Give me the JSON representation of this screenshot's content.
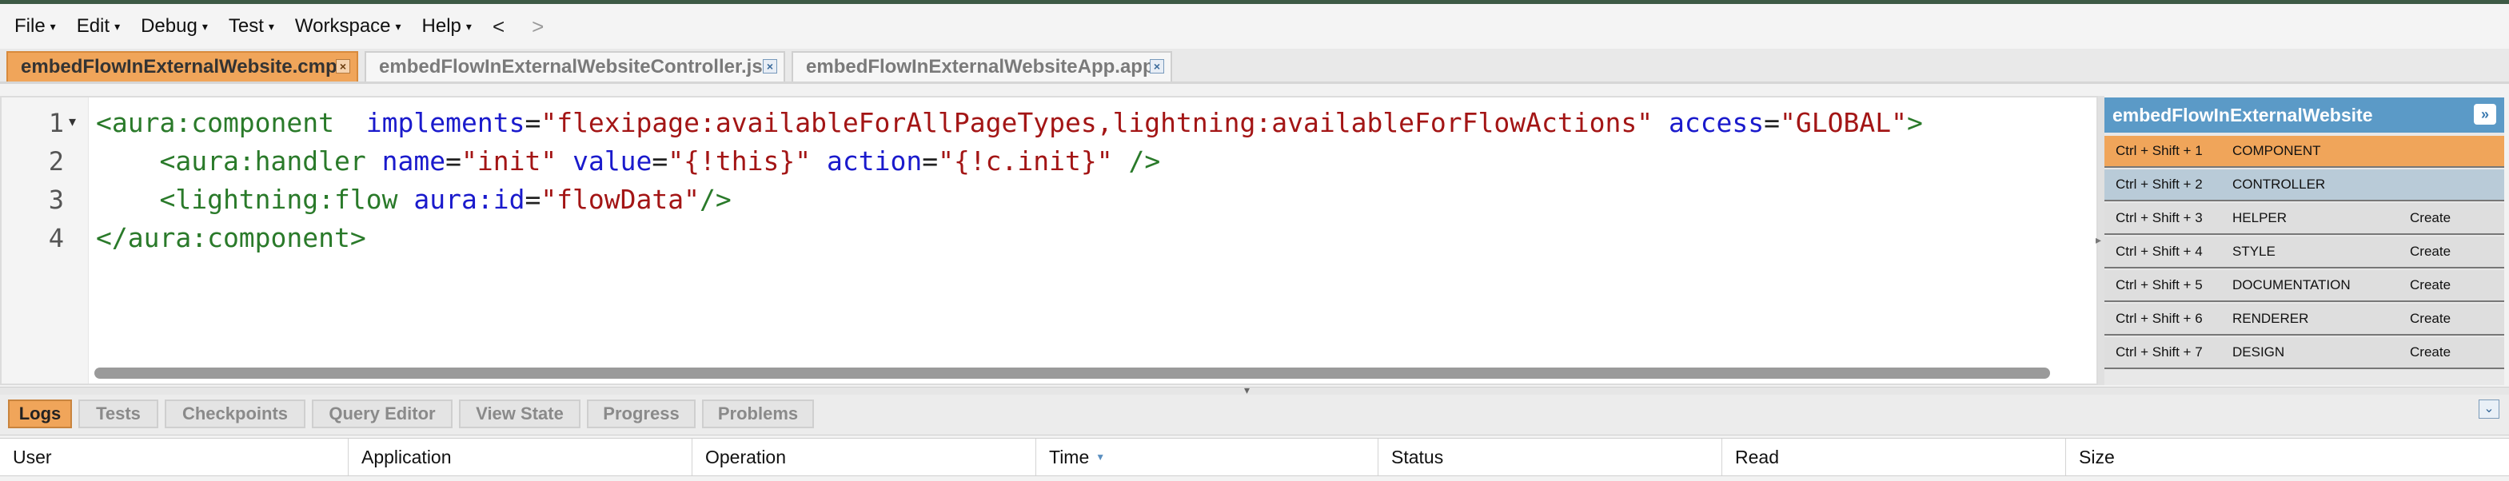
{
  "menu": {
    "items": [
      "File",
      "Edit",
      "Debug",
      "Test",
      "Workspace",
      "Help"
    ],
    "back": "<",
    "forward": ">"
  },
  "tabs": [
    {
      "label": "embedFlowInExternalWebsite.cmp",
      "active": true
    },
    {
      "label": "embedFlowInExternalWebsiteController.js",
      "active": false
    },
    {
      "label": "embedFlowInExternalWebsiteApp.app",
      "active": false
    }
  ],
  "tab_close_glyph": "×",
  "editor": {
    "line_numbers": [
      "1",
      "2",
      "3",
      "4"
    ],
    "fold_marker": "▾",
    "lines": [
      [
        {
          "t": "tag",
          "v": "<aura:component  "
        },
        {
          "t": "attr",
          "v": "implements"
        },
        {
          "t": "eq",
          "v": "="
        },
        {
          "t": "str",
          "v": "\"flexipage:availableForAllPageTypes,lightning:availableForFlowActions\""
        },
        {
          "t": "eq",
          "v": " "
        },
        {
          "t": "attr",
          "v": "access"
        },
        {
          "t": "eq",
          "v": "="
        },
        {
          "t": "str",
          "v": "\"GLOBAL\""
        },
        {
          "t": "tag",
          "v": ">"
        }
      ],
      [
        {
          "t": "tag",
          "v": "    <aura:handler "
        },
        {
          "t": "attr",
          "v": "name"
        },
        {
          "t": "eq",
          "v": "="
        },
        {
          "t": "str",
          "v": "\"init\""
        },
        {
          "t": "eq",
          "v": " "
        },
        {
          "t": "attr",
          "v": "value"
        },
        {
          "t": "eq",
          "v": "="
        },
        {
          "t": "str",
          "v": "\"{!this}\""
        },
        {
          "t": "eq",
          "v": " "
        },
        {
          "t": "attr",
          "v": "action"
        },
        {
          "t": "eq",
          "v": "="
        },
        {
          "t": "str",
          "v": "\"{!c.init}\""
        },
        {
          "t": "tag",
          "v": " />"
        }
      ],
      [
        {
          "t": "tag",
          "v": "    <lightning:flow "
        },
        {
          "t": "attr",
          "v": "aura:id"
        },
        {
          "t": "eq",
          "v": "="
        },
        {
          "t": "str",
          "v": "\"flowData\""
        },
        {
          "t": "tag",
          "v": "/>"
        }
      ],
      [
        {
          "t": "tag",
          "v": "</aura:component>"
        }
      ]
    ]
  },
  "side_panel": {
    "title": "embedFlowInExternalWebsite",
    "collapse_glyph": "»",
    "rows": [
      {
        "shortcut": "Ctrl + Shift + 1",
        "name": "COMPONENT",
        "action": "",
        "state": "active"
      },
      {
        "shortcut": "Ctrl + Shift + 2",
        "name": "CONTROLLER",
        "action": "",
        "state": "ctrl"
      },
      {
        "shortcut": "Ctrl + Shift + 3",
        "name": "HELPER",
        "action": "Create",
        "state": ""
      },
      {
        "shortcut": "Ctrl + Shift + 4",
        "name": "STYLE",
        "action": "Create",
        "state": ""
      },
      {
        "shortcut": "Ctrl + Shift + 5",
        "name": "DOCUMENTATION",
        "action": "Create",
        "state": ""
      },
      {
        "shortcut": "Ctrl + Shift + 6",
        "name": "RENDERER",
        "action": "Create",
        "state": ""
      },
      {
        "shortcut": "Ctrl + Shift + 7",
        "name": "DESIGN",
        "action": "Create",
        "state": ""
      }
    ]
  },
  "bottom_tabs": [
    {
      "label": "Logs",
      "active": true
    },
    {
      "label": "Tests",
      "active": false
    },
    {
      "label": "Checkpoints",
      "active": false
    },
    {
      "label": "Query Editor",
      "active": false
    },
    {
      "label": "View State",
      "active": false
    },
    {
      "label": "Progress",
      "active": false
    },
    {
      "label": "Problems",
      "active": false
    }
  ],
  "bottom_collapse_glyph": "⌄",
  "log_columns": [
    "User",
    "Application",
    "Operation",
    "Time",
    "Status",
    "Read",
    "Size"
  ],
  "sort_glyph": "▼",
  "colors": {
    "active_tab": "#f0a55a",
    "side_header": "#5b9ac7",
    "controller_row": "#b9cbd8"
  }
}
